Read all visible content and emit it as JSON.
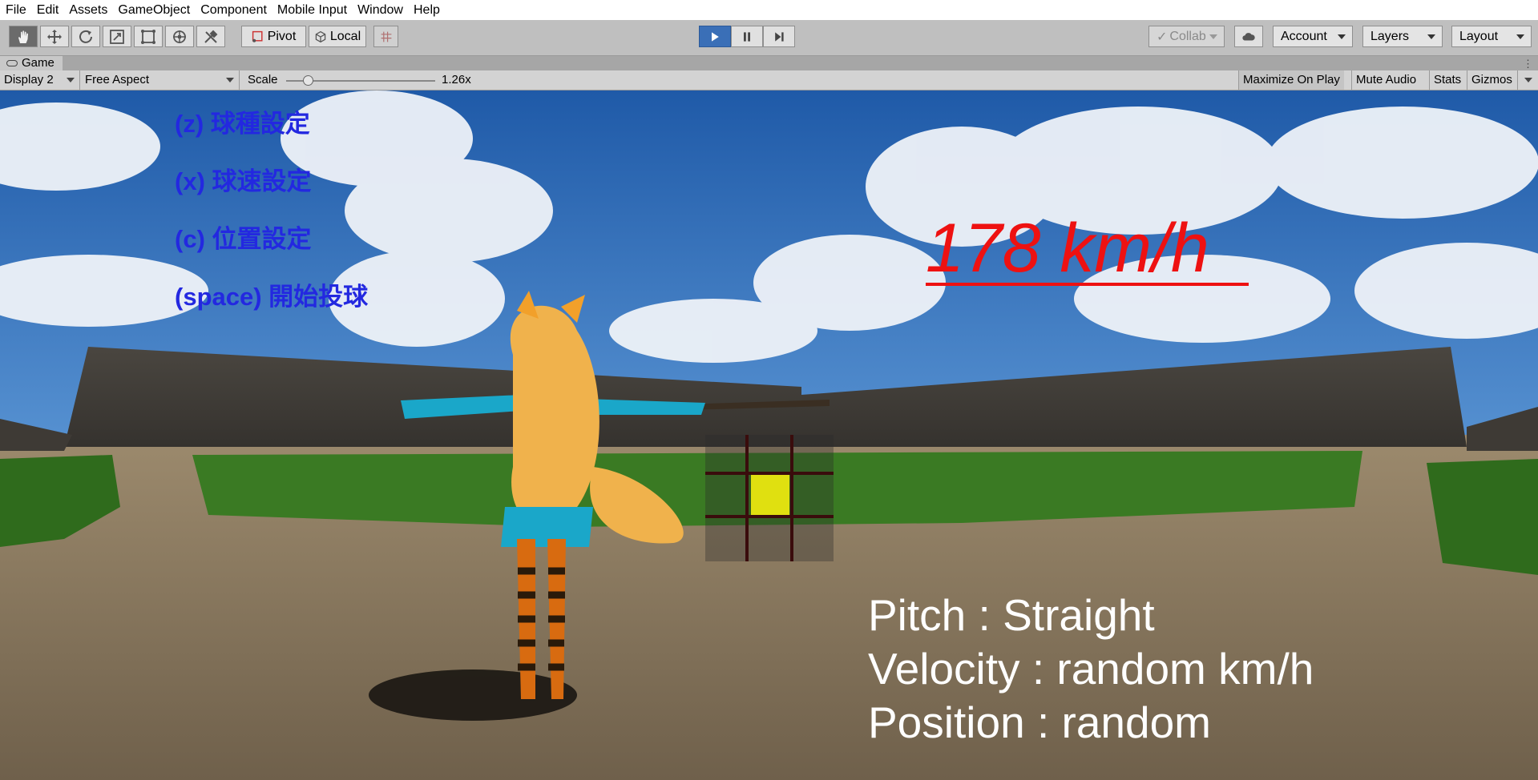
{
  "menu": [
    "File",
    "Edit",
    "Assets",
    "GameObject",
    "Component",
    "Mobile Input",
    "Window",
    "Help"
  ],
  "toolbar": {
    "tools": [
      {
        "name": "hand-tool-icon"
      },
      {
        "name": "move-tool-icon"
      },
      {
        "name": "rotate-tool-icon"
      },
      {
        "name": "scale-tool-icon"
      },
      {
        "name": "rect-tool-icon"
      },
      {
        "name": "transform-tool-icon"
      },
      {
        "name": "custom-tool-icon"
      }
    ],
    "pivot_label": "Pivot",
    "local_label": "Local",
    "collab_label": "Collab",
    "account_label": "Account",
    "layers_label": "Layers",
    "layout_label": "Layout"
  },
  "game_tab": {
    "title": "Game",
    "display": "Display 2",
    "aspect": "Free Aspect",
    "scale_label": "Scale",
    "scale_value": "1.26x",
    "scale_level": 0.15,
    "maximize_label": "Maximize On Play",
    "mute_label": "Mute Audio",
    "stats_label": "Stats",
    "gizmos_label": "Gizmos"
  },
  "hud": {
    "controls": [
      "(z) 球種設定",
      "(x) 球速設定",
      "(c) 位置設定",
      "(space) 開始投球"
    ],
    "speed": "178 km/h",
    "pitch": "Pitch : Straight",
    "velocity": "Velocity :  random   km/h",
    "position": "Position : random"
  },
  "colors": {
    "control_text": "#2328e0",
    "speed_text": "#ee1111",
    "info_text": "#ffffff",
    "target_zone": "#e0e010",
    "play_button": "#3a6fb7"
  }
}
